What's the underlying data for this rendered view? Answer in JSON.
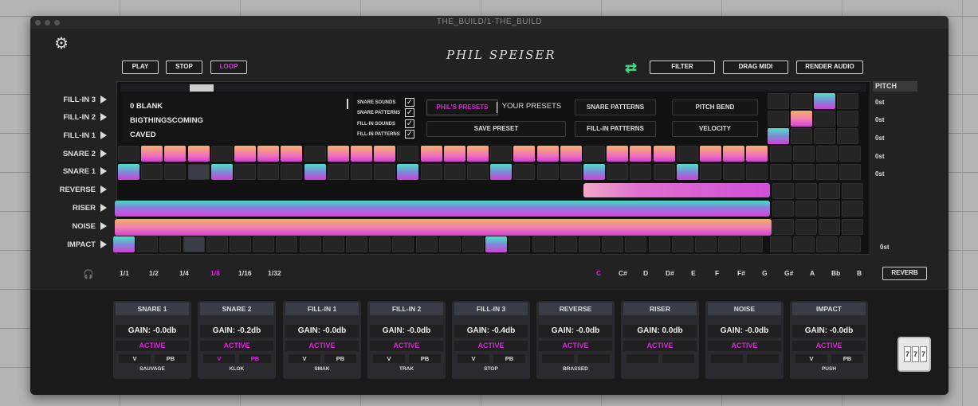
{
  "window": {
    "title": "THE_BUILD/1-THE_BUILD"
  },
  "brand": {
    "logo_text": "PHIL SPEISER"
  },
  "transport": {
    "play": "PLAY",
    "stop": "STOP",
    "loop": "LOOP"
  },
  "topbar": {
    "filter": "FILTER",
    "drag_midi": "DRAG MIDI",
    "render_audio": "RENDER AUDIO"
  },
  "rows": [
    "FILL-IN 3",
    "FILL-IN 2",
    "FILL-IN 1",
    "SNARE 2",
    "SNARE 1",
    "REVERSE",
    "RISER",
    "NOISE",
    "IMPACT"
  ],
  "presets": {
    "items": [
      "0 BLANK",
      "BIGTHINGSCOMING",
      "CAVED"
    ]
  },
  "checks": {
    "labels": [
      "SNARE SOUNDS",
      "SNARE PATTERNS",
      "FILL-IN SOUNDS",
      "FILL-IN PATTERNS"
    ],
    "mark": "✓"
  },
  "preset_tabs": {
    "phils": "PHIL'S PRESETS",
    "yours": "YOUR PRESETS",
    "save": "SAVE PRESET"
  },
  "pattern_buttons": {
    "snare_patterns": "SNARE PATTERNS",
    "pitch_bend": "PITCH BEND",
    "fillin_patterns": "FILL-IN PATTERNS",
    "velocity": "VELOCITY"
  },
  "pitch": {
    "label": "PITCH",
    "values": [
      "0st",
      "0st",
      "0st",
      "0st",
      "0st",
      "0st"
    ]
  },
  "divisions": [
    "1/1",
    "1/2",
    "1/4",
    "1/8",
    "1/16",
    "1/32"
  ],
  "notes": [
    "C",
    "C#",
    "D",
    "D#",
    "E",
    "F",
    "F#",
    "G",
    "G#",
    "A",
    "Bb",
    "B"
  ],
  "reverb": "REVERB",
  "channels": [
    {
      "name": "SNARE 1",
      "gain": "GAIN: -0.0db",
      "status": "ACTIVE",
      "v": "V",
      "pb": "PB",
      "sample": "SAUVAGE"
    },
    {
      "name": "SNARE 2",
      "gain": "GAIN: -0.2db",
      "status": "ACTIVE",
      "v": "V",
      "pb": "PB",
      "sample": "KLOK"
    },
    {
      "name": "FILL-IN 1",
      "gain": "GAIN: -0.0db",
      "status": "ACTIVE",
      "v": "V",
      "pb": "PB",
      "sample": "SMAK"
    },
    {
      "name": "FILL-IN 2",
      "gain": "GAIN: -0.0db",
      "status": "ACTIVE",
      "v": "V",
      "pb": "PB",
      "sample": "TRAK"
    },
    {
      "name": "FILL-IN 3",
      "gain": "GAIN: -0.4db",
      "status": "ACTIVE",
      "v": "V",
      "pb": "PB",
      "sample": "STOP"
    },
    {
      "name": "REVERSE",
      "gain": "GAIN: -0.0db",
      "status": "ACTIVE",
      "v": "",
      "pb": "",
      "sample": "BRASSED"
    },
    {
      "name": "RISER",
      "gain": "GAIN: 0.0db",
      "status": "ACTIVE",
      "v": "",
      "pb": "",
      "sample": ""
    },
    {
      "name": "NOISE",
      "gain": "GAIN: -0.0db",
      "status": "ACTIVE",
      "v": "",
      "pb": "",
      "sample": ""
    },
    {
      "name": "IMPACT",
      "gain": "GAIN: -0.0db",
      "status": "ACTIVE",
      "v": "V",
      "pb": "PB",
      "sample": "PUSH"
    }
  ],
  "colors": {
    "accent": "#e020e0",
    "swap": "#3ddc84",
    "background": "#222222"
  }
}
